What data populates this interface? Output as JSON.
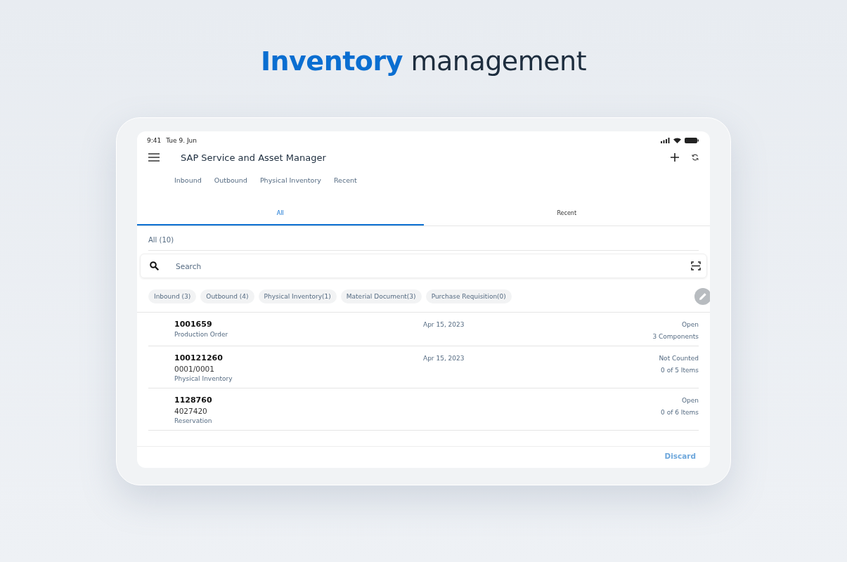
{
  "headline": "**Inventory** management",
  "status_bar": {
    "time": "9:41",
    "date": "Tue 9. Jun"
  },
  "app_bar": {
    "title": "SAP Service and Asset Manager"
  },
  "nav_links": [
    "Inbound",
    "Outbound",
    "Physical Inventory",
    "Recent"
  ],
  "tabs": [
    {
      "label": "All",
      "selected": true
    },
    {
      "label": "Recent",
      "selected": false
    }
  ],
  "list_header": "All (10)",
  "search": {
    "placeholder": "Search"
  },
  "filter_chips": [
    "Inbound (3)",
    "Outbound (4)",
    "Physical Inventory(1)",
    "Material Document(3)",
    "Purchase Requisition(0)"
  ],
  "rows": [
    {
      "number": "1001659",
      "date": "Apr 15, 2023",
      "type": "Production Order",
      "status": "Open",
      "count": "3 Components"
    },
    {
      "number": "100121260",
      "date": "Apr 15, 2023",
      "reference": "0001/0001",
      "type": "Physical Inventory",
      "status": "Not Counted",
      "count": "0 of 5 Items"
    },
    {
      "number": "1128760",
      "reference": "4027420",
      "type": "Reservation",
      "status": "Open",
      "count": "0 of 6 Items"
    }
  ],
  "footer": {
    "button": "Discard"
  }
}
